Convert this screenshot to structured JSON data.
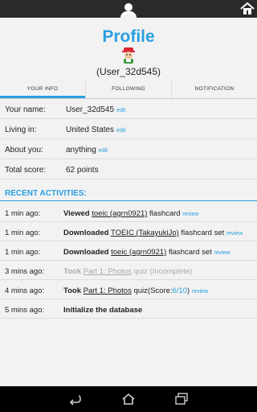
{
  "header": {
    "title": "Profile",
    "username": "(User_32d545)"
  },
  "tabs": [
    {
      "label": "YOUR INFO",
      "active": true
    },
    {
      "label": "FOLLOWING",
      "active": false
    },
    {
      "label": "NOTIFICATION",
      "active": false
    }
  ],
  "info": {
    "name_label": "Your name:",
    "name_value": "User_32d545",
    "living_label": "Living in:",
    "living_value": "United States",
    "about_label": "About you:",
    "about_value": "anything",
    "score_label": "Total score:",
    "score_value": "62 points",
    "edit_label": "edit"
  },
  "activities": {
    "title": "RECENT ACTIVITIES:",
    "review_label": "review",
    "items": [
      {
        "time": "1 min ago:",
        "verb": "Viewed",
        "link": "toeic (agrn0921)",
        "rest": "flashcard"
      },
      {
        "time": "1 min ago:",
        "verb": "Downloaded",
        "link": "TOEIC (TakayukiJo)",
        "rest": "flashcard set"
      },
      {
        "time": "1 min ago:",
        "verb": "Downloaded",
        "link": "toeic (agrn0921)",
        "rest": "flashcard set"
      },
      {
        "time": "3 mins ago:",
        "verb": "Took",
        "link": "Part 1: Photos",
        "rest": "quiz (Incomplete)"
      },
      {
        "time": "4 mins ago:",
        "verb": "Took",
        "link": "Part 1: Photos",
        "rest": "quiz(Score:",
        "score": "6/10",
        "close": ")"
      },
      {
        "time": "5 mins ago:",
        "verb": "Initialize the database"
      }
    ]
  },
  "colors": {
    "accent": "#2a9fe0",
    "topbar": "#2a2a2a",
    "navbar": "#000000"
  },
  "icons": {
    "topbar": [
      "user-icon",
      "home-icon"
    ],
    "navbar": [
      "back-icon",
      "home-icon",
      "recent-apps-icon"
    ]
  }
}
